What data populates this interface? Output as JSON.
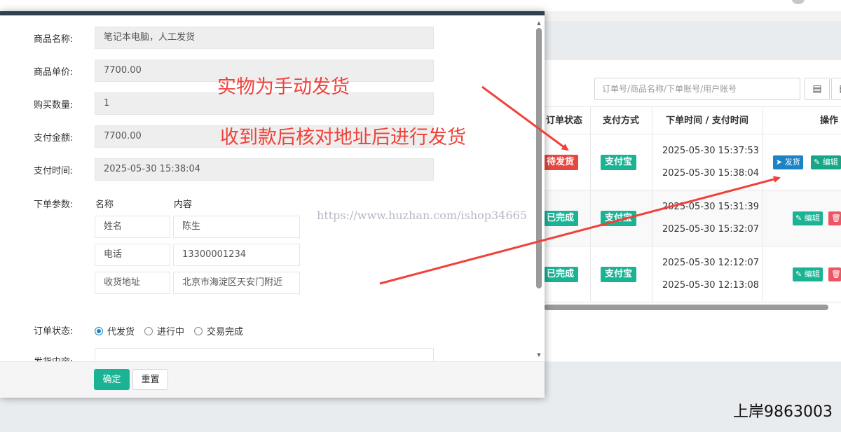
{
  "form": {
    "product_name_label": "商品名称:",
    "product_name_value": "笔记本电脑，人工发货",
    "unit_price_label": "商品单价:",
    "unit_price_value": "7700.00",
    "quantity_label": "购买数量:",
    "quantity_value": "1",
    "pay_amount_label": "支付金额:",
    "pay_amount_value": "7700.00",
    "pay_time_label": "支付时间:",
    "pay_time_value": "2025-05-30 15:38:04",
    "order_params_label": "下单参数:",
    "params_header_name": "名称",
    "params_header_content": "内容",
    "params": [
      {
        "name": "姓名",
        "content": "陈生"
      },
      {
        "name": "电话",
        "content": "13300001234"
      },
      {
        "name": "收货地址",
        "content": "北京市海淀区天安门附近"
      }
    ],
    "order_status_label": "订单状态:",
    "status_options": [
      "代发货",
      "进行中",
      "交易完成"
    ],
    "status_selected": "代发货",
    "delivery_content_label": "发货内容:",
    "confirm_label": "确定",
    "reset_label": "重置"
  },
  "toolbar": {
    "search_placeholder": "订单号/商品名称/下单账号/用户账号",
    "list_icon": "list-icon",
    "columns_icon": "columns-icon"
  },
  "table": {
    "headers": {
      "status": "订单状态",
      "payment": "支付方式",
      "times": "下单时间 / 支付时间",
      "actions": "操作"
    },
    "rows": [
      {
        "status": "待发货",
        "status_color": "#e8473f",
        "payment": "支付宝",
        "order_time": "2025-05-30 15:37:53",
        "pay_time": "2025-05-30 15:38:04",
        "actions": [
          "发货",
          "编辑"
        ]
      },
      {
        "status": "已完成",
        "status_color": "#1ab394",
        "payment": "支付宝",
        "order_time": "2025-05-30 15:31:39",
        "pay_time": "2025-05-30 15:32:07",
        "actions": [
          "编辑"
        ]
      },
      {
        "status": "已完成",
        "status_color": "#1ab394",
        "payment": "支付宝",
        "order_time": "2025-05-30 12:12:07",
        "pay_time": "2025-05-30 12:13:08",
        "actions": [
          "编辑"
        ]
      }
    ]
  },
  "annotations": {
    "line1": "实物为手动发货",
    "line2": "收到款后核对地址后进行发货",
    "watermark": "https://www.huzhan.com/ishop34665",
    "corner": "上岸9863003",
    "arrow_color": "#f0413a"
  },
  "colors": {
    "primary": "#1ab394",
    "danger": "#ed5565",
    "info": "#1c84c6",
    "modal_top": "#2f4050"
  }
}
